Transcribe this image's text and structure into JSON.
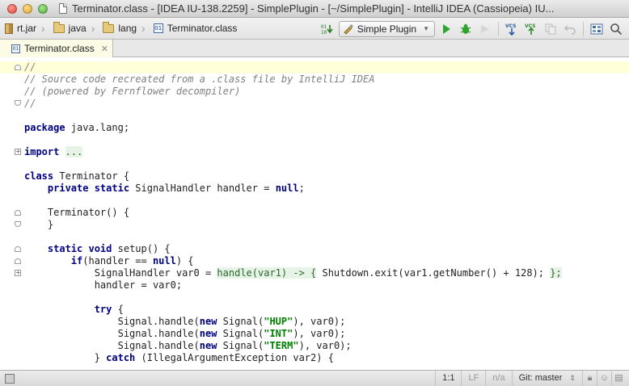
{
  "window": {
    "title": "Terminator.class - [IDEA IU-138.2259] - SimplePlugin - [~/SimplePlugin] - IntelliJ IDEA (Cassiopeia) IU..."
  },
  "breadcrumbs": [
    {
      "label": "rt.jar",
      "icon": "jar-icon"
    },
    {
      "label": "java",
      "icon": "folder-icon"
    },
    {
      "label": "lang",
      "icon": "folder-icon"
    },
    {
      "label": "Terminator.class",
      "icon": "class-file-icon"
    }
  ],
  "toolbar": {
    "run_config": "Simple Plugin",
    "vcs_update": "VCS",
    "vcs_commit": "VCS"
  },
  "tabs": [
    {
      "label": "Terminator.class",
      "icon_text": "01"
    }
  ],
  "code_lines": [
    "//",
    "// Source code recreated from a .class file by IntelliJ IDEA",
    "// (powered by Fernflower decompiler)",
    "//",
    "",
    "package java.lang;",
    "",
    "import ...",
    "",
    "class Terminator {",
    "    private static SignalHandler handler = null;",
    "",
    "    Terminator() {",
    "    }",
    "",
    "    static void setup() {",
    "        if(handler == null) {",
    "            SignalHandler var0 = handle(var1) -> { Shutdown.exit(var1.getNumber() + 128); };",
    "            handler = var0;",
    "",
    "            try {",
    "                Signal.handle(new Signal(\"HUP\"), var0);",
    "                Signal.handle(new Signal(\"INT\"), var0);",
    "                Signal.handle(new Signal(\"TERM\"), var0);",
    "            } catch (IllegalArgumentException var2) {"
  ],
  "status": {
    "position": "1:1",
    "line_separator": "LF",
    "encoding": "n/a",
    "vcs_branch": "Git: master"
  }
}
